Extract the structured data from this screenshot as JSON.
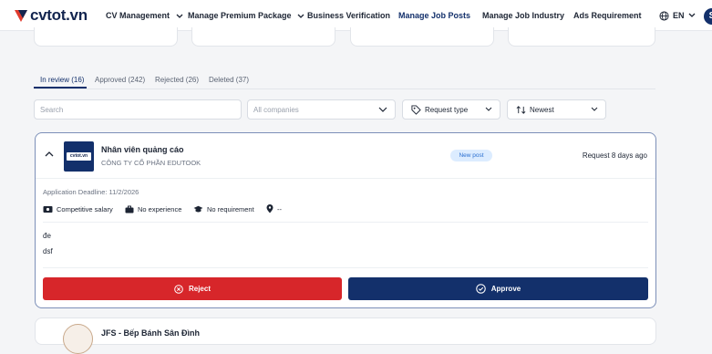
{
  "brand": {
    "name": "cvtot.vn",
    "accent": "#13306b",
    "logo_mark_color": "#e03a2d"
  },
  "nav": {
    "items": [
      {
        "label": "CV Management",
        "has_dropdown": true
      },
      {
        "label": "Manage Premium Package",
        "has_dropdown": true
      },
      {
        "label": "Business Verification",
        "has_dropdown": false
      },
      {
        "label": "Manage Job Posts",
        "has_dropdown": false,
        "active": true
      },
      {
        "label": "Manage Job Industry",
        "has_dropdown": false
      },
      {
        "label": "Ads Requirement",
        "has_dropdown": false
      }
    ],
    "language": "EN",
    "avatar_initial": "S"
  },
  "tabs": [
    {
      "label": "In review (16)",
      "active": true
    },
    {
      "label": "Approved (242)"
    },
    {
      "label": "Rejected (26)"
    },
    {
      "label": "Deleted (37)"
    }
  ],
  "filters": {
    "search_placeholder": "Search",
    "company_placeholder": "All companies",
    "request_type_label": "Request type",
    "sort_label": "Newest"
  },
  "job_card": {
    "title": "Nhân viên quảng cáo",
    "company": "CÔNG TY CỔ PHẦN EDUTOOK",
    "logo_text": "cvtot.vn",
    "badge": "New post",
    "request_time": "Request 8 days ago",
    "deadline": "Application Deadline: 11/2/2026",
    "requirements": {
      "salary": "Competitive salary",
      "experience": "No experience",
      "education": "No requirement",
      "location": "--"
    },
    "description_lines": [
      "đe",
      "dsf"
    ],
    "reject_label": "Reject",
    "approve_label": "Approve",
    "reject_color": "#d7262a",
    "approve_color": "#13306b",
    "badge_color": "#dcecff"
  },
  "next_card": {
    "title": "JFS - Bếp Bánh Sân Đình"
  },
  "icons": {
    "collapse": "chevron-up-icon",
    "salary": "money-icon",
    "experience": "briefcase-icon",
    "education": "graduation-cap-icon",
    "location": "map-pin-icon",
    "reject": "x-circle-icon",
    "approve": "check-circle-icon",
    "request_type": "tag-icon",
    "sort": "sort-icon",
    "language": "globe-icon"
  }
}
